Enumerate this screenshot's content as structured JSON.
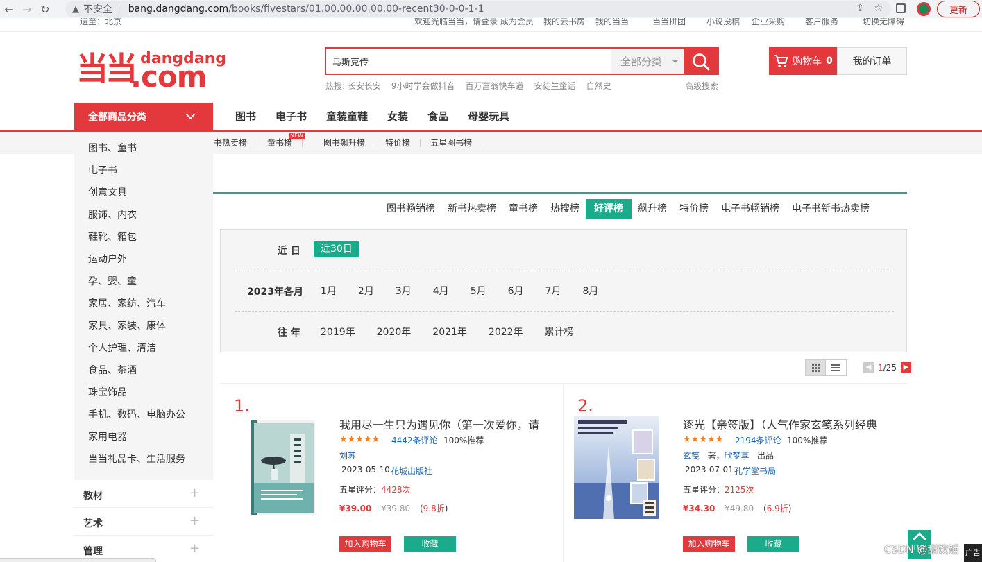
{
  "browser": {
    "insecure_label": "不安全",
    "url_host": "bang.dangdang.com",
    "url_path": "/books/fivestars/01.00.00.00.00.00-recent30-0-0-1-1",
    "update_label": "更新"
  },
  "topbar": {
    "location": "送至：北京",
    "welcome": "欢迎光临当当，请登录 成为会员",
    "links": [
      "我的云书房",
      "我的当当",
      "当当拼团",
      "小说投稿",
      "企业采购",
      "客户服务",
      "切换无障碍"
    ]
  },
  "logo": {
    "mark": "当当",
    "brand_top": "dangdang",
    "brand_bottom": ".com"
  },
  "search": {
    "query": "马斯克传",
    "category_label": "全部分类",
    "hot_prefix": "热搜:",
    "hot_words": [
      "长安长安",
      "9小时学会做抖音",
      "百万富翁快车道",
      "安徒生童话",
      "自然史"
    ],
    "advanced_label": "高级搜索"
  },
  "cart": {
    "label": "购物车",
    "count": "0"
  },
  "orders_label": "我的订单",
  "nav": {
    "all_categories": "全部商品分类",
    "items": [
      "图书",
      "电子书",
      "童装童鞋",
      "女装",
      "食品",
      "母婴玩具"
    ]
  },
  "subnav": {
    "items": [
      "新书热卖榜",
      "童书榜",
      "图书飙升榜",
      "特价榜",
      "五星图书榜"
    ],
    "new_badge": "NEW"
  },
  "category_menu": {
    "items": [
      "图书、童书",
      "电子书",
      "创意文具",
      "服饰、内衣",
      "鞋靴、箱包",
      "运动户外",
      "孕、婴、童",
      "家居、家纺、汽车",
      "家具、家装、康体",
      "个人护理、清洁",
      "食品、茶酒",
      "珠宝饰品",
      "手机、数码、电脑办公",
      "家用电器",
      "当当礼品卡、生活服务"
    ],
    "sections": [
      "教材",
      "艺术",
      "管理"
    ],
    "expand_symbol": "+"
  },
  "rank_tabs": [
    "图书畅销榜",
    "新书热卖榜",
    "童书榜",
    "热搜榜",
    "好评榜",
    "飙升榜",
    "特价榜",
    "电子书畅销榜",
    "电子书新书热卖榜"
  ],
  "active_tab": "好评榜",
  "time_filter": {
    "recent_label": "近 日",
    "recent_option": "近30日",
    "month_label": "2023年各月",
    "months": [
      "1月",
      "2月",
      "3月",
      "4月",
      "5月",
      "6月",
      "7月",
      "8月"
    ],
    "years_label": "往 年",
    "years": [
      "2019年",
      "2020年",
      "2021年",
      "2022年",
      "累计榜"
    ]
  },
  "pager": {
    "prev": "◀",
    "current": "1",
    "total": "/25",
    "next": "▶"
  },
  "products": [
    {
      "rank": "1.",
      "title": "我用尽一生只为遇见你（第一次爱你，请",
      "rating": 5,
      "reviews": "4442条评论",
      "recommend": "100%推荐",
      "author": "刘苏",
      "author_suffix": "",
      "co_author": "",
      "imprint_suffix": "",
      "pub_date": "2023-05-10",
      "publisher": "花城出版社",
      "five_star_label": "五星评分：",
      "five_star_count": "4428次",
      "price": "¥39.00",
      "list_price": "¥39.80",
      "discount_open": "(",
      "discount": "9.8折",
      "discount_close": ")",
      "cover_title": "我用尽一生只为遇见你",
      "add_cart": "加入购物车",
      "favorite": "收藏"
    },
    {
      "rank": "2.",
      "title": "逐光【亲签版】（人气作家玄笺系列经典",
      "rating": 5,
      "reviews": "2194条评论",
      "recommend": "100%推荐",
      "author": "玄笺",
      "author_suffix": "著，",
      "co_author": "欣梦享",
      "imprint_suffix": "出品",
      "pub_date": "2023-07-01",
      "publisher": "孔学堂书局",
      "five_star_label": "五星评分：",
      "five_star_count": "2125次",
      "price": "¥34.30",
      "list_price": "¥49.80",
      "discount_open": "(",
      "discount": "6.9折",
      "discount_close": ")",
      "cover_title": "人气作家 玄笺 系列经典之作",
      "cover_badge": "随书附赠",
      "add_cart": "加入购物车",
      "favorite": "收藏"
    }
  ],
  "floating": {
    "top_label": "TOP",
    "ad_label": "广告",
    "watermark": "CSDN @甜饮铺"
  },
  "colors": {
    "brand_red": "#e4393c",
    "accent_green": "#1aab8a",
    "link_blue": "#1a66b3",
    "star_orange": "#f57c1f"
  }
}
